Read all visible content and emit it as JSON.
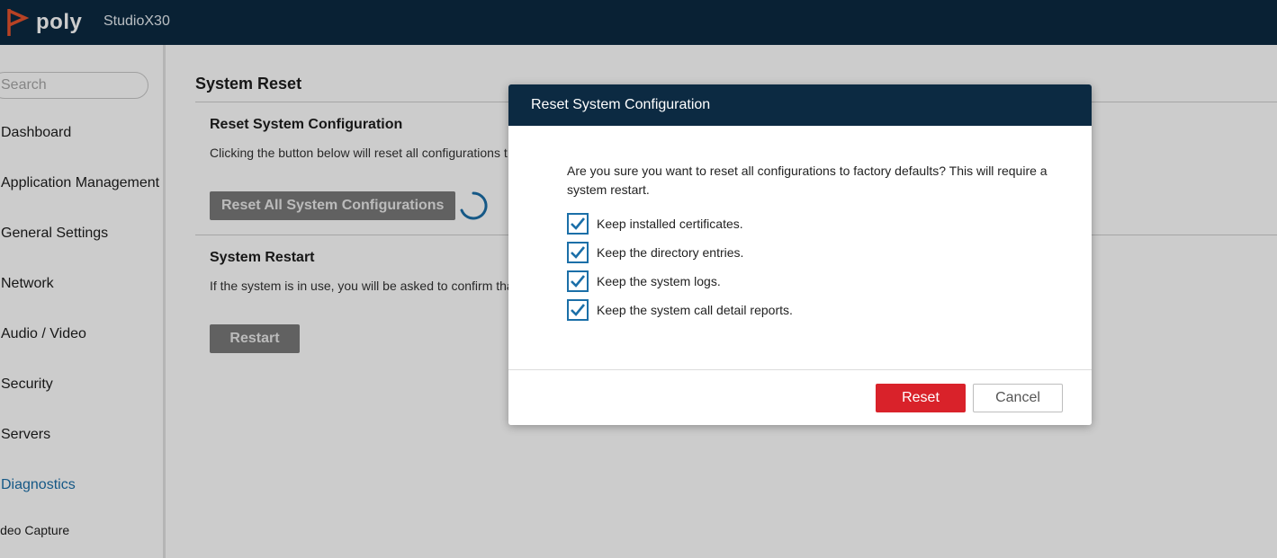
{
  "header": {
    "brand": "poly",
    "device_name": "StudioX30",
    "logo_icon": "poly-logo-icon"
  },
  "sidebar": {
    "search_placeholder": "Search",
    "items": [
      {
        "label": "Dashboard"
      },
      {
        "label": "Application Management"
      },
      {
        "label": "General Settings"
      },
      {
        "label": "Network"
      },
      {
        "label": "Audio / Video"
      },
      {
        "label": "Security"
      },
      {
        "label": "Servers"
      },
      {
        "label": "Diagnostics"
      }
    ],
    "sub_item": "ideo Capture"
  },
  "main": {
    "page_title": "System Reset",
    "reset_section": {
      "title": "Reset System Configuration",
      "description": "Clicking the button below will reset all configurations t",
      "button_label": "Reset All System Configurations"
    },
    "restart_section": {
      "title": "System Restart",
      "description": "If the system is in use, you will be asked to confirm tha",
      "button_label": "Restart"
    }
  },
  "modal": {
    "title": "Reset System Configuration",
    "message": "Are you sure you want to reset all configurations to factory defaults? This will require a system restart.",
    "options": [
      {
        "label": "Keep installed certificates.",
        "checked": true
      },
      {
        "label": "Keep the directory entries.",
        "checked": true
      },
      {
        "label": "Keep the system logs.",
        "checked": true
      },
      {
        "label": "Keep the system call detail reports.",
        "checked": true
      }
    ],
    "reset_label": "Reset",
    "cancel_label": "Cancel"
  },
  "colors": {
    "header_bg": "#0c2a42",
    "accent_blue": "#1b6fa8",
    "danger_red": "#d9222a",
    "logo_orange": "#e5532d"
  }
}
